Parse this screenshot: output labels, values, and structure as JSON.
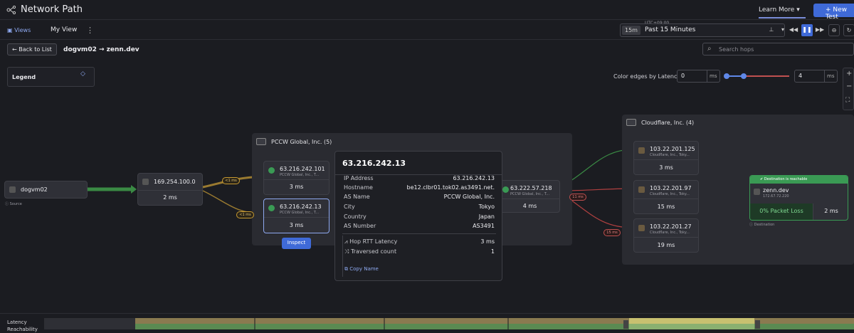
{
  "header": {
    "title": "Network Path",
    "learn_more": "Learn More",
    "new_test": "+ New Test"
  },
  "toolbar": {
    "views": "Views",
    "my_view": "My View",
    "timezone": "UTC+09:00",
    "range_short": "15m",
    "range_label": "Past 15 Minutes"
  },
  "nav": {
    "back": "Back to List",
    "source": "dogvm02",
    "destination": "zenn.dev",
    "search_placeholder": "Search hops"
  },
  "legend": {
    "label": "Legend"
  },
  "latency": {
    "label": "Color edges by Latency",
    "min": "0",
    "max": "4",
    "unit": "ms"
  },
  "source_node": {
    "name": "dogvm02",
    "caption": "Source"
  },
  "hop1": {
    "ip": "169.254.100.0",
    "ms": "2 ms"
  },
  "pccw": {
    "title": "PCCW Global, Inc. (5)",
    "hops": [
      {
        "ip": "63.216.242.101",
        "org": "PCCW Global, Inc., T...",
        "ms": "3 ms"
      },
      {
        "ip": "63.216.242.13",
        "org": "PCCW Global, Inc., T...",
        "ms": "3 ms"
      }
    ],
    "hop_right": {
      "ip": "63.222.57.218",
      "org": "PCCW Global, Inc., T...",
      "ms": "4 ms"
    }
  },
  "badges": {
    "b1": "<1 ms",
    "b2": "<1 ms",
    "b3": "11 ms",
    "b4": "15 ms"
  },
  "inspect": "Inspect",
  "tooltip": {
    "title": "63.216.242.13",
    "rows": [
      {
        "k": "IP Address",
        "v": "63.216.242.13"
      },
      {
        "k": "Hostname",
        "v": "be12.clbr01.tok02.as3491.net."
      },
      {
        "k": "AS Name",
        "v": "PCCW Global, Inc."
      },
      {
        "k": "City",
        "v": "Tokyo"
      },
      {
        "k": "Country",
        "v": "Japan"
      },
      {
        "k": "AS Number",
        "v": "AS3491"
      }
    ],
    "rows2": [
      {
        "k": "Hop RTT Latency",
        "v": "3 ms"
      },
      {
        "k": "Traversed count",
        "v": "1"
      }
    ],
    "copy": "Copy Name"
  },
  "cloudflare": {
    "title": "Cloudflare, Inc. (4)",
    "hops": [
      {
        "ip": "103.22.201.125",
        "org": "Cloudflare, Inc., Toky...",
        "ms": "3 ms"
      },
      {
        "ip": "103.22.201.97",
        "org": "Cloudflare, Inc., Toky...",
        "ms": "15 ms"
      },
      {
        "ip": "103.22.201.27",
        "org": "Cloudflare, Inc., Toky...",
        "ms": "19 ms"
      }
    ]
  },
  "dest": {
    "header": "Destination is reachable",
    "name": "zenn.dev",
    "ip": "172.67.72.220",
    "loss": "0% Packet Loss",
    "ms": "2 ms",
    "caption": "Destination"
  },
  "bottom": {
    "latency": "Latency",
    "reachability": "Reachability"
  }
}
